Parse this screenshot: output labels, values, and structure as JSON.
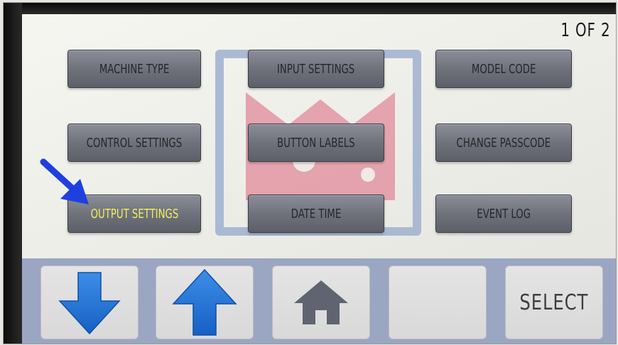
{
  "screen": {
    "page_indicator": "1 OF 2",
    "buttons": {
      "machine_type": "MACHINE TYPE",
      "input_settings": "INPUT SETTINGS",
      "model_code": "MODEL CODE",
      "control_settings": "CONTROL SETTINGS",
      "button_labels": "BUTTON LABELS",
      "change_passcode": "CHANGE PASSCODE",
      "output_settings": "OUTPUT SETTINGS",
      "date_time": "DATE TIME",
      "event_log": "EVENT LOG"
    },
    "highlighted_button": "output_settings",
    "highlight_color": "#f1ef5a"
  },
  "bottom_bar": {
    "down_icon": "arrow-down-icon",
    "up_icon": "arrow-up-icon",
    "home_icon": "home-icon",
    "select_label": "SELECT"
  },
  "annotation": {
    "icon": "pointer-arrow-icon",
    "color": "#1f3fe0"
  },
  "colors": {
    "arrow_blue": "#1e73d6",
    "home_gray": "#5f6470",
    "logo_pink": "#e08a9a",
    "logo_frame": "#9fb0cf"
  }
}
